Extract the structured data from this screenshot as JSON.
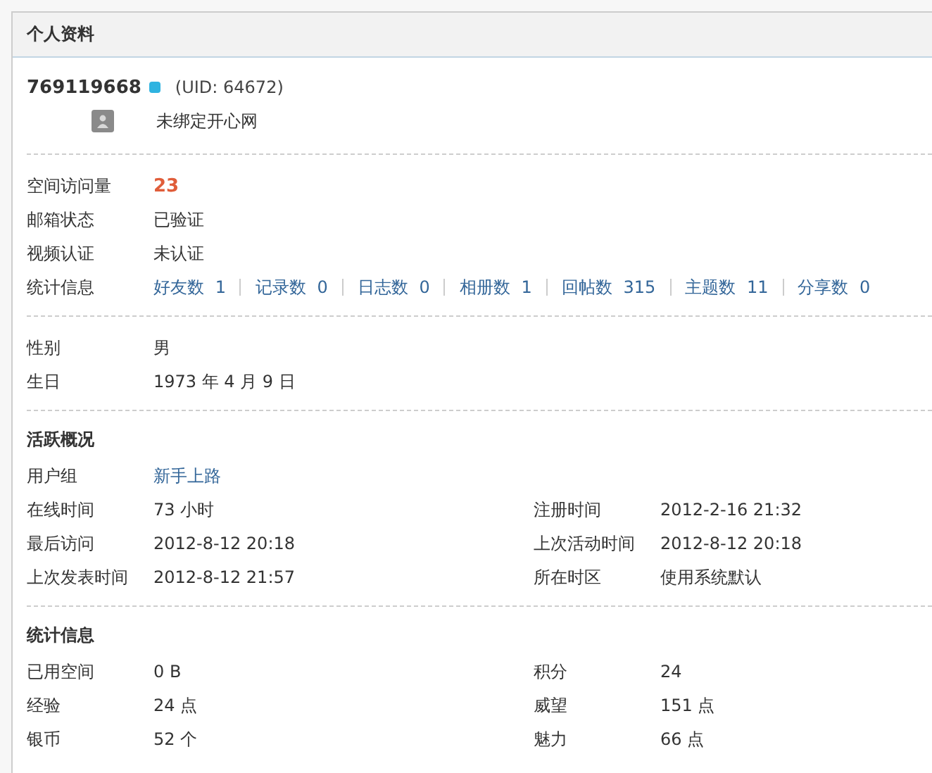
{
  "panel": {
    "title": "个人资料"
  },
  "profile": {
    "username": "769119668",
    "uid": "(UID: 64672)",
    "kaixin": "未绑定开心网"
  },
  "basic": [
    {
      "label": "空间访问量",
      "value": "23",
      "kind": "highlight"
    },
    {
      "label": "邮箱状态",
      "value": "已验证",
      "kind": "text"
    },
    {
      "label": "视频认证",
      "value": "未认证",
      "kind": "text"
    },
    {
      "label": "统计信息",
      "kind": "stats",
      "stats": [
        {
          "label": "好友数",
          "count": "1"
        },
        {
          "label": "记录数",
          "count": "0"
        },
        {
          "label": "日志数",
          "count": "0"
        },
        {
          "label": "相册数",
          "count": "1"
        },
        {
          "label": "回帖数",
          "count": "315"
        },
        {
          "label": "主题数",
          "count": "11"
        },
        {
          "label": "分享数",
          "count": "0"
        }
      ]
    }
  ],
  "personal": [
    {
      "label": "性别",
      "value": "男"
    },
    {
      "label": "生日",
      "value": "1973 年 4 月 9 日"
    }
  ],
  "activity": {
    "heading": "活跃概况",
    "group": {
      "label": "用户组",
      "value": "新手上路"
    },
    "items": [
      {
        "label": "在线时间",
        "value": "73 小时"
      },
      {
        "label": "注册时间",
        "value": "2012-2-16 21:32"
      },
      {
        "label": "最后访问",
        "value": "2012-8-12 20:18"
      },
      {
        "label": "上次活动时间",
        "value": "2012-8-12 20:18"
      },
      {
        "label": "上次发表时间",
        "value": "2012-8-12 21:57"
      },
      {
        "label": "所在时区",
        "value": "使用系统默认"
      }
    ]
  },
  "statistics": {
    "heading": "统计信息",
    "items": [
      {
        "label": "已用空间",
        "value": "0 B"
      },
      {
        "label": "积分",
        "value": "24"
      },
      {
        "label": "经验",
        "value": "24 点"
      },
      {
        "label": "威望",
        "value": "151 点"
      },
      {
        "label": "银币",
        "value": "52 个"
      },
      {
        "label": "魅力",
        "value": "66 点"
      }
    ]
  }
}
